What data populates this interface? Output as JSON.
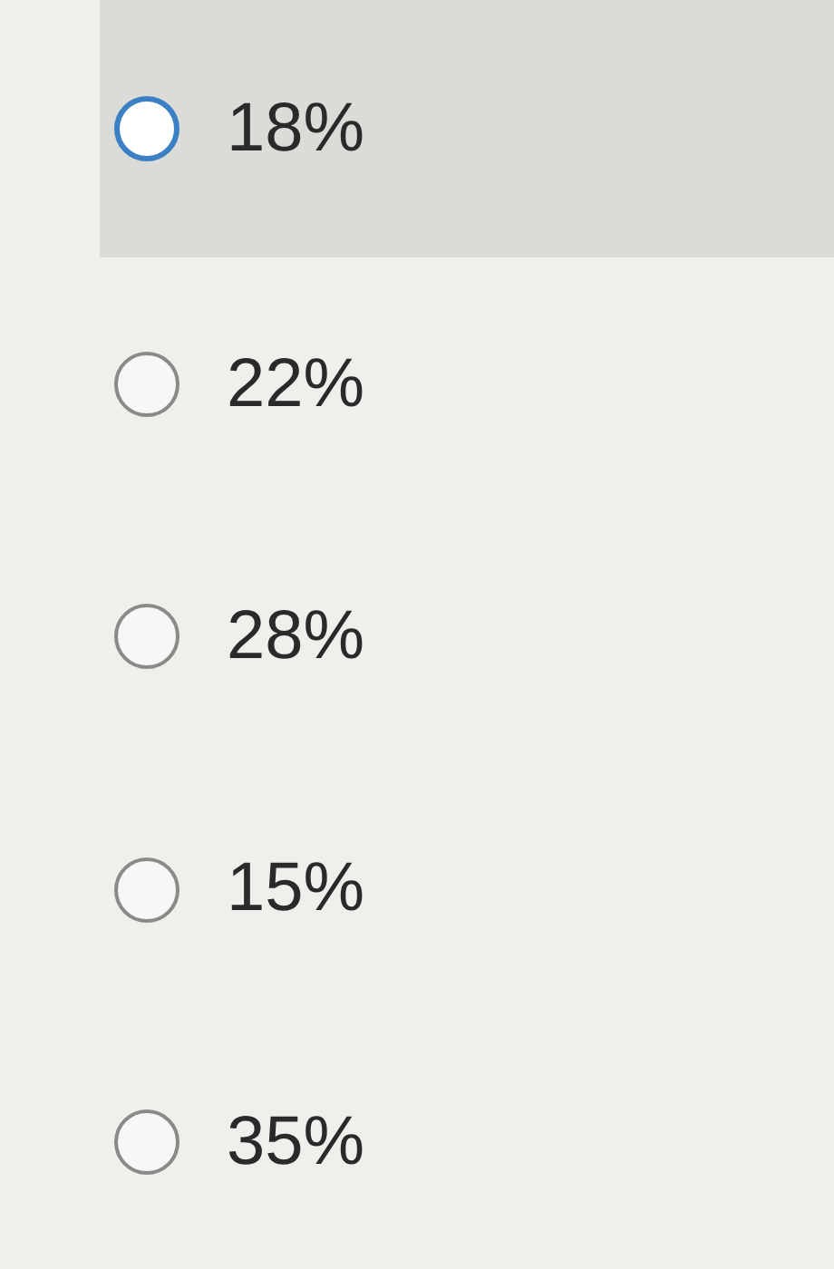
{
  "options": [
    {
      "label": "18%",
      "highlighted": true
    },
    {
      "label": "22%",
      "highlighted": false
    },
    {
      "label": "28%",
      "highlighted": false
    },
    {
      "label": "15%",
      "highlighted": false
    },
    {
      "label": "35%",
      "highlighted": false
    }
  ]
}
